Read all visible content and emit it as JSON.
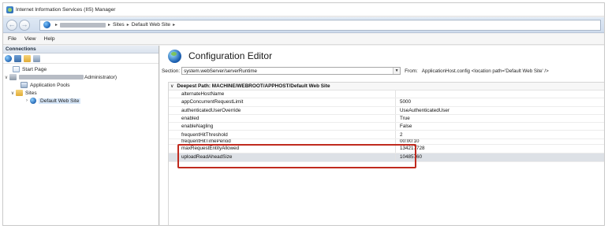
{
  "window": {
    "title": "Internet Information Services (IIS) Manager"
  },
  "address": {
    "crumbs": [
      "Sites",
      "Default Web Site"
    ],
    "separator": "▸"
  },
  "menu": [
    "File",
    "View",
    "Help"
  ],
  "connections": {
    "header": "Connections",
    "tree": {
      "start_page": "Start Page",
      "server_suffix": "Administrator)",
      "app_pools": "Application Pools",
      "sites": "Sites",
      "default_site": "Default Web Site"
    }
  },
  "editor": {
    "title": "Configuration Editor",
    "section_label": "Section:",
    "section_value": "system.webServer/serverRuntime",
    "from_label": "From:",
    "from_value": "ApplicationHost.config <location path='Default Web Site' />",
    "group_header": "Deepest Path: MACHINE/WEBROOT/APPHOST/Default Web Site",
    "rows": [
      {
        "name": "alternateHostName",
        "value": ""
      },
      {
        "name": "appConcurrentRequestLimit",
        "value": "5000"
      },
      {
        "name": "authenticatedUserOverride",
        "value": "UseAuthenticatedUser"
      },
      {
        "name": "enabled",
        "value": "True"
      },
      {
        "name": "enableNagling",
        "value": "False"
      },
      {
        "name": "frequentHitThreshold",
        "value": "2"
      },
      {
        "name": "frequentHitTimePeriod",
        "value": "00:00:10"
      },
      {
        "name": "maxRequestEntityAllowed",
        "value": "134217728"
      },
      {
        "name": "uploadReadAheadSize",
        "value": "10485760"
      }
    ]
  },
  "colors": {
    "highlight": "#c02a1e",
    "selected_row": "#dde1e6"
  }
}
